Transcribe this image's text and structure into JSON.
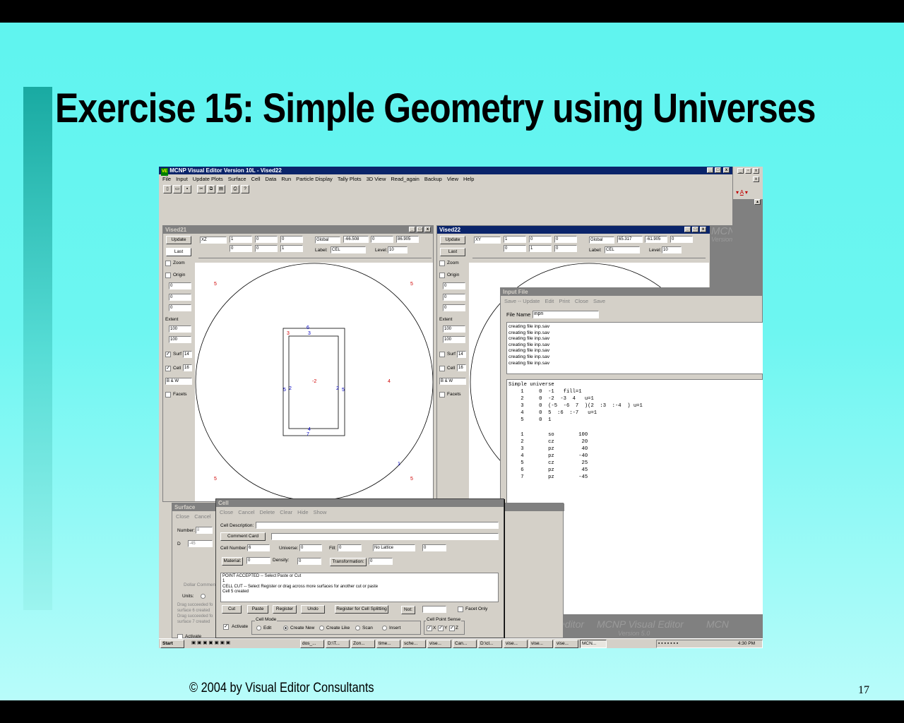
{
  "slide": {
    "title": "Exercise 15: Simple Geometry using Universes",
    "copyright": "© 2004 by Visual Editor Consultants",
    "page_number": "17"
  },
  "app": {
    "title": "MCNP Visual Editor Version 10L - Vised22",
    "menu": [
      "File",
      "Input",
      "Update Plots",
      "Surface",
      "Cell",
      "Data",
      "Run",
      "Particle Display",
      "Tally Plots",
      "3D View",
      "Read_again",
      "Backup",
      "View",
      "Help"
    ]
  },
  "plot_left": {
    "title": "Vised21",
    "update_label": "Update",
    "last_label": "Last",
    "zoom_label": "Zoom",
    "origin_label": "Origin",
    "origin_values": [
      "0",
      "0",
      "0"
    ],
    "extent_label": "Extent",
    "extent_values": [
      "100",
      "100"
    ],
    "surf_label": "Surf",
    "surf_value": "14",
    "cell_label": "Cell",
    "cell_value": "16",
    "color_mode": "B & W",
    "facets_label": "Facets",
    "plane": "XZ",
    "basis_row1": [
      "1",
      "0",
      "0"
    ],
    "basis_row2": [
      "0",
      "0",
      "1"
    ],
    "coord_mode": "Global",
    "coord_values": [
      "-66.508",
      "0",
      "86.905"
    ],
    "label_caption": "Label:",
    "label_value": "CEL",
    "level_caption": "Level:",
    "level_value": "10",
    "marks": [
      "5",
      "5",
      "5",
      "5",
      "3",
      "6",
      "3",
      "-2",
      "4",
      "5",
      "2",
      "2",
      "5",
      "4",
      "7",
      "1"
    ]
  },
  "plot_right": {
    "title": "Vised22",
    "update_label": "Update",
    "last_label": "Last",
    "zoom_label": "Zoom",
    "origin_label": "Origin",
    "origin_values": [
      "0",
      "0",
      "0"
    ],
    "extent_label": "Extent",
    "extent_values": [
      "100",
      "100"
    ],
    "surf_label": "Surf",
    "surf_value": "14",
    "cell_label": "Cell",
    "cell_value": "16",
    "color_mode": "B & W",
    "facets_label": "Facets",
    "plane": "XY",
    "basis_row1": [
      "1",
      "0",
      "0"
    ],
    "basis_row2": [
      "0",
      "1",
      "0"
    ],
    "coord_mode": "Global",
    "coord_values": [
      "65.317",
      "-61.905",
      "0"
    ],
    "label_caption": "Label:",
    "label_value": "CEL",
    "level_caption": "Level:",
    "level_value": "10"
  },
  "input_file": {
    "title": "Input File",
    "menu": [
      "Save -- Update",
      "Edit",
      "Print",
      "Close",
      "Save"
    ],
    "file_name_label": "File Name",
    "file_name": "inpn",
    "log": "creating file inp.sav\ncreating file inp.sav\ncreating file inp.sav\ncreating file inp.sav\ncreating file inp.sav\ncreating file inp.sav\ncreating file inp.sav",
    "content": "Simple universe\n    1     0  -1   fill=1\n    2     0  -2  -3  4   u=1\n    3     0  (-5  -6  7  )(2  :3  :-4  ) u=1\n    4     0  5  :6  :-7   u=1\n    5     0  1\n\n    1        so        100\n    2        cz         20\n    3        pz         40\n    4        pz        -40\n    5        cz         25\n    6        pz         45\n    7        pz        -45"
  },
  "surface_dialog": {
    "title": "Surface",
    "menu": [
      "Close",
      "Cancel"
    ],
    "number_label": "Number:",
    "number_value": "8",
    "d_label": "D",
    "d_value": "-45",
    "dollar_label": "Dollar Comment",
    "units_label": "Units:",
    "log": "Drag succeeded fo\nsurface 6 created\nDrag succeeded fo\nsurface 7 created",
    "activate_label": "Activate"
  },
  "cell_dialog": {
    "title": "Cell",
    "menu": [
      "Close",
      "Cancel",
      "Delete",
      "Clear",
      "Hide",
      "Show"
    ],
    "description_label": "Cell Description:",
    "comment_card_label": "Comment Card",
    "cell_number_label": "Cell Number:",
    "cell_number": "6",
    "universe_label": "Universe:",
    "universe_value": "0",
    "fill_label": "Fill:",
    "fill_value": "0",
    "lattice_value": "No Lattice",
    "lattice_extra": "0",
    "material_label": "Material:",
    "material_value": "0",
    "density_label": "Density:",
    "density_value": "0",
    "transformation_label": "Transformation:",
    "transformation_value": "0",
    "messages": "POINT ACCEPTED -- Select Paste or Cut\n1\nCELL CUT -- Select Register or drag across more surfaces for another cut or paste\nCell 5 created",
    "buttons": [
      "Cut",
      "Paste",
      "Register",
      "Undo",
      "Register for Cell Splitting",
      "Not:"
    ],
    "facet_only_label": "Facet Only",
    "activate_label": "Activate",
    "cell_mode_label": "Cell Mode",
    "modes": [
      "Edit",
      "Create New",
      "Create Like",
      "Scan",
      "Insert"
    ],
    "point_sense_label": "Cell Point Sense",
    "sense_axes": [
      "X",
      "Y",
      "Z"
    ]
  },
  "watermark": {
    "text": "MCNP Visual Editor",
    "version": "Version 5.0",
    "short": "MCN",
    "short_version": "Version"
  },
  "taskbar": {
    "start": "Start",
    "tasks": [
      "dos_...",
      "D:\\T...",
      "Zon...",
      "time...",
      "sche...",
      "vise...",
      "Can...",
      "D:\\cl...",
      "vise...",
      "vise...",
      "vise...",
      "MCN..."
    ],
    "clock": "4:30 PM"
  }
}
